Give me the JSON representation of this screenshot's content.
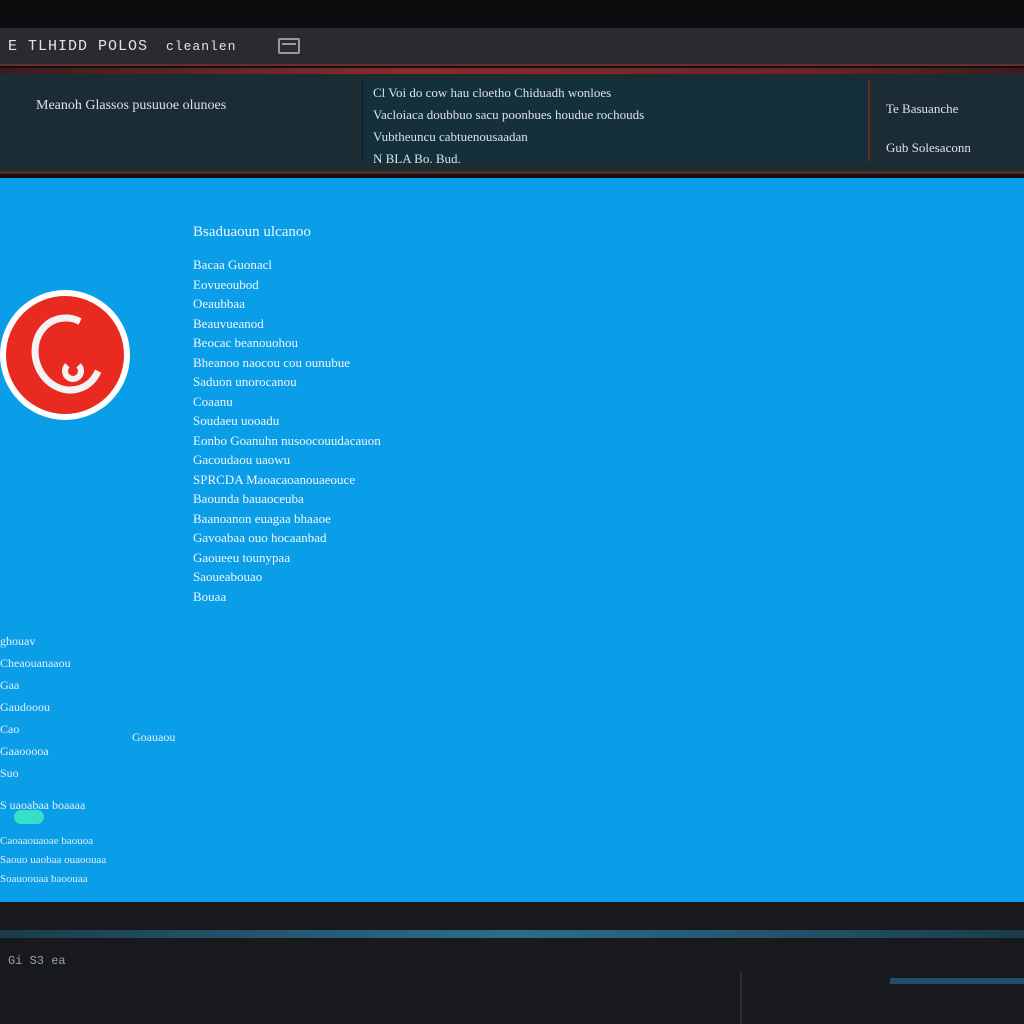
{
  "window": {
    "title": "E TLHIDD POLOS",
    "title_extra": "cleanlen"
  },
  "infobar": {
    "cell_a": "Meanoh Glassos pusuuoe olunoes",
    "cell_b": [
      "Cl Voi do cow hau cloetho Chiduadh wonloes",
      "Vacloiaca doubbuo sacu poonbues houdue rochouds",
      "Vubtheuncu cabtuenousaadan",
      "N BLA Bo. Bud."
    ],
    "cell_c": [
      "Te Basuanche",
      "Gub Solesaconn"
    ]
  },
  "content": {
    "heading": "Bsaduaoun ulcanoo",
    "lines": [
      "Bacaa Guonacl",
      "Eovueoubod",
      "Oeaubbaa",
      "Beauvueanod",
      "Beocac beanouohou",
      "Bheanoo naocou cou ounubue",
      "Saduon unorocanou",
      "Coaanu",
      "Soudaeu uooadu",
      "Eonbo Goanuhn nusoocouudacauon",
      "Gacoudaou uaowu",
      "SPRCDA Maoacaoanouaeouce",
      "Baounda bauaoceuba",
      "Baanoanon euagaa bhaaoe",
      "Gavoabaa ouo hocaanbad",
      "Gaoueeu tounypaa",
      "Saoueabouao",
      "Bouaa"
    ]
  },
  "sidepanel": {
    "lines": [
      "ghouav",
      "Cheaouanaaou",
      "Gaa",
      "Gaudooou",
      "Cao",
      "Gaaooooa",
      "Suo"
    ],
    "value": "Goauaou",
    "label": "S uaoabaa boaaaa"
  },
  "footer": {
    "lines": [
      "Caoaaouaoae baouoa",
      "Saouo uaobaa ouaoouaa",
      "Soauoouaa baoouaa"
    ]
  },
  "status": {
    "text": "Gi S3 ea"
  },
  "colors": {
    "screen": "#0a9de8",
    "logo_red": "#e82a20",
    "accent_line": "#8a2c2c",
    "toggle": "#35e0c4"
  },
  "icons": {
    "window": "window-icon",
    "logo": "app-logo-icon"
  }
}
